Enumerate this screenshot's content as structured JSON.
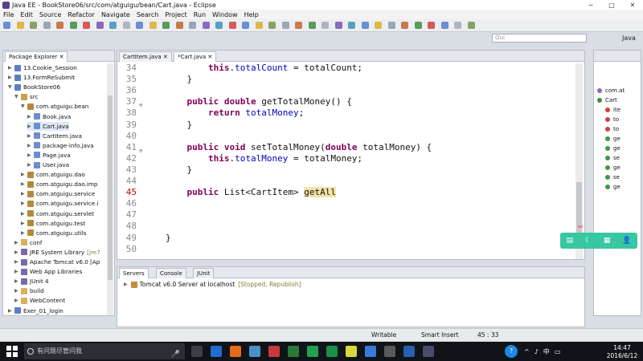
{
  "window": {
    "title": "Java EE - BookStore06/src/com/atguigu/bean/Cart.java - Eclipse"
  },
  "menu": [
    "File",
    "Edit",
    "Source",
    "Refactor",
    "Navigate",
    "Search",
    "Project",
    "Run",
    "Window",
    "Help"
  ],
  "quick_access": {
    "placeholder": "Qui"
  },
  "perspective": {
    "label": "Java"
  },
  "package_explorer": {
    "tab_label": "Package Explorer",
    "items": [
      {
        "label": "13.Cookie_Session",
        "indent": 1,
        "expanded": false,
        "icon": "project"
      },
      {
        "label": "13.FormReSubmit",
        "indent": 1,
        "expanded": false,
        "icon": "project"
      },
      {
        "label": "BookStore06",
        "indent": 1,
        "expanded": true,
        "icon": "project"
      },
      {
        "label": "src",
        "indent": 2,
        "expanded": true,
        "icon": "source-folder"
      },
      {
        "label": "com.atguigu.bean",
        "indent": 3,
        "expanded": true,
        "icon": "package"
      },
      {
        "label": "Book.java",
        "indent": 4,
        "expanded": false,
        "icon": "java-file"
      },
      {
        "label": "Cart.java",
        "indent": 4,
        "expanded": false,
        "icon": "java-file",
        "selected": true
      },
      {
        "label": "CartItem.java",
        "indent": 4,
        "expanded": false,
        "icon": "java-file"
      },
      {
        "label": "package-info.java",
        "indent": 4,
        "expanded": false,
        "icon": "java-file"
      },
      {
        "label": "Page.java",
        "indent": 4,
        "expanded": false,
        "icon": "java-file"
      },
      {
        "label": "User.java",
        "indent": 4,
        "expanded": false,
        "icon": "java-file"
      },
      {
        "label": "com.atguigu.dao",
        "indent": 3,
        "expanded": false,
        "icon": "package"
      },
      {
        "label": "com.atguigu.dao.imp",
        "indent": 3,
        "expanded": false,
        "icon": "package"
      },
      {
        "label": "com.atguigu.service",
        "indent": 3,
        "expanded": false,
        "icon": "package"
      },
      {
        "label": "com.atguigu.service.i",
        "indent": 3,
        "expanded": false,
        "icon": "package"
      },
      {
        "label": "com.atguigu.servlet",
        "indent": 3,
        "expanded": false,
        "icon": "package"
      },
      {
        "label": "com.atguigu.test",
        "indent": 3,
        "expanded": false,
        "icon": "package"
      },
      {
        "label": "com.atguigu.utils",
        "indent": 3,
        "expanded": false,
        "icon": "package"
      },
      {
        "label": "conf",
        "indent": 2,
        "expanded": false,
        "icon": "folder"
      },
      {
        "label": "JRE System Library",
        "suffix": "[jre7",
        "indent": 2,
        "expanded": false,
        "icon": "library"
      },
      {
        "label": "Apache Tomcat v6.0 [Ap",
        "indent": 2,
        "expanded": false,
        "icon": "library"
      },
      {
        "label": "Web App Libraries",
        "indent": 2,
        "expanded": false,
        "icon": "library"
      },
      {
        "label": "JUnit 4",
        "indent": 2,
        "expanded": false,
        "icon": "library"
      },
      {
        "label": "build",
        "indent": 2,
        "expanded": false,
        "icon": "folder"
      },
      {
        "label": "WebContent",
        "indent": 2,
        "expanded": false,
        "icon": "folder"
      },
      {
        "label": "Exer_01_login",
        "indent": 1,
        "expanded": false,
        "icon": "project"
      }
    ]
  },
  "editor": {
    "tabs": [
      {
        "label": "CartItem.java",
        "active": false
      },
      {
        "label": "*Cart.java",
        "active": true
      }
    ],
    "lines": [
      {
        "num": "34",
        "tokens": [
          {
            "t": "        "
          },
          {
            "t": "this",
            "c": "kw"
          },
          {
            "t": "."
          },
          {
            "t": "totalCount",
            "c": "fld"
          },
          {
            "t": " = totalCount;"
          }
        ]
      },
      {
        "num": "35",
        "tokens": [
          {
            "t": "    }"
          }
        ]
      },
      {
        "num": "36",
        "tokens": []
      },
      {
        "num": "37",
        "mark": "⊖",
        "tokens": [
          {
            "t": "    "
          },
          {
            "t": "public",
            "c": "kw"
          },
          {
            "t": " "
          },
          {
            "t": "double",
            "c": "kw"
          },
          {
            "t": " getTotalMoney() {"
          }
        ]
      },
      {
        "num": "38",
        "tokens": [
          {
            "t": "        "
          },
          {
            "t": "return",
            "c": "kw"
          },
          {
            "t": " "
          },
          {
            "t": "totalMoney",
            "c": "fld"
          },
          {
            "t": ";"
          }
        ]
      },
      {
        "num": "39",
        "tokens": [
          {
            "t": "    }"
          }
        ]
      },
      {
        "num": "40",
        "tokens": []
      },
      {
        "num": "41",
        "mark": "⊖",
        "tokens": [
          {
            "t": "    "
          },
          {
            "t": "public",
            "c": "kw"
          },
          {
            "t": " "
          },
          {
            "t": "void",
            "c": "kw"
          },
          {
            "t": " setTotalMoney("
          },
          {
            "t": "double",
            "c": "kw"
          },
          {
            "t": " totalMoney) {"
          }
        ]
      },
      {
        "num": "42",
        "tokens": [
          {
            "t": "        "
          },
          {
            "t": "this",
            "c": "kw"
          },
          {
            "t": "."
          },
          {
            "t": "totalMoney",
            "c": "fld"
          },
          {
            "t": " = totalMoney;"
          }
        ]
      },
      {
        "num": "43",
        "tokens": [
          {
            "t": "    }"
          }
        ]
      },
      {
        "num": "44",
        "tokens": []
      },
      {
        "num": "45",
        "err": true,
        "tokens": [
          {
            "t": "    "
          },
          {
            "t": "public",
            "c": "kw"
          },
          {
            "t": " List<CartItem> "
          },
          {
            "t": "getAll",
            "c": "hl"
          }
        ]
      },
      {
        "num": "46",
        "tokens": []
      },
      {
        "num": "47",
        "tokens": []
      },
      {
        "num": "48",
        "tokens": []
      },
      {
        "num": "49",
        "tokens": [
          {
            "t": "}"
          }
        ]
      },
      {
        "num": "50",
        "tokens": []
      }
    ]
  },
  "servers": {
    "tabs": [
      "Servers",
      "Console",
      "JUnit"
    ],
    "row": {
      "name": "Tomcat v6.0 Server at localhost",
      "status": "[Stopped, Republish]"
    }
  },
  "outline": {
    "items": [
      {
        "label": "com.at",
        "color": "#8e6bb8"
      },
      {
        "label": "Cart",
        "color": "#3c8f3c"
      },
      {
        "label": "ite",
        "color": "#d04040"
      },
      {
        "label": "to",
        "color": "#d04040"
      },
      {
        "label": "to",
        "color": "#d04040"
      },
      {
        "label": "ge",
        "color": "#3c9b3c"
      },
      {
        "label": "ge",
        "color": "#3c9b3c"
      },
      {
        "label": "se",
        "color": "#3c9b3c"
      },
      {
        "label": "ge",
        "color": "#3c9b3c"
      },
      {
        "label": "se",
        "color": "#3c9b3c"
      },
      {
        "label": "ge",
        "color": "#3c9b3c"
      }
    ]
  },
  "status_bar": {
    "writable": "Writable",
    "insert_mode": "Smart Insert",
    "position": "45 : 33"
  },
  "taskbar": {
    "search_placeholder": "有问题尽管问我",
    "clock_time": "14:47",
    "clock_date": "2016/6/12",
    "tray_lang": "中"
  },
  "colors": {
    "accent_float": "#37c7a1",
    "keyword": "#7f0055",
    "field": "#0000c0"
  }
}
